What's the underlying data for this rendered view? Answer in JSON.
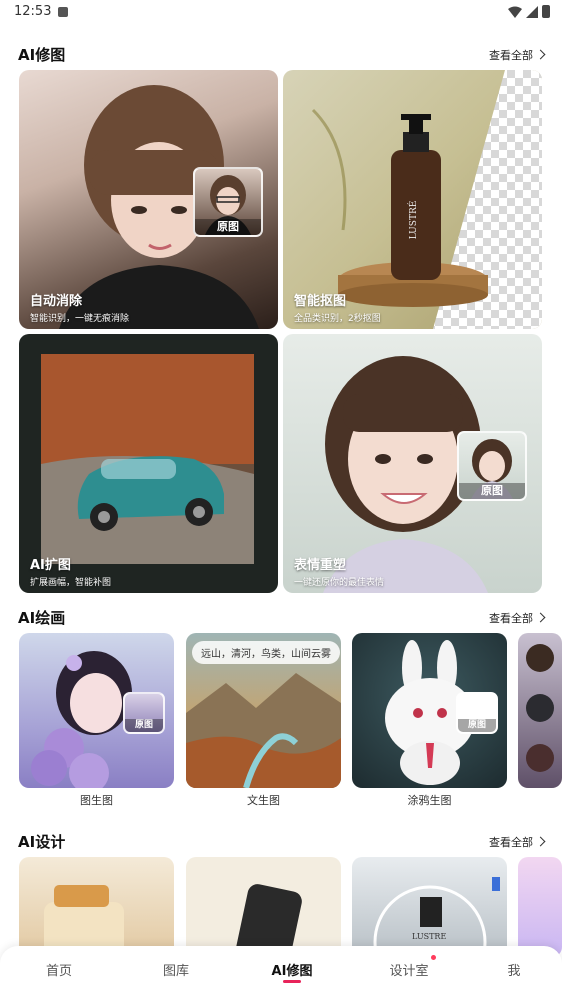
{
  "status_bar": {
    "time": "12:53"
  },
  "sections": {
    "retouch": {
      "title": "AI修图",
      "see_all": "查看全部",
      "cards": [
        {
          "title": "自动消除",
          "subtitle": "智能识别，一键无痕消除",
          "badge": "原图"
        },
        {
          "title": "智能抠图",
          "subtitle": "全品类识别，2秒抠图",
          "product_text": "LUSTRÉ"
        },
        {
          "title": "AI扩图",
          "subtitle": "扩展画幅，智能补图"
        },
        {
          "title": "表情重塑",
          "subtitle": "一键还原你的最佳表情",
          "badge": "原图"
        }
      ]
    },
    "painting": {
      "title": "AI绘画",
      "see_all": "查看全部",
      "items": [
        {
          "caption": "图生图",
          "badge": "原图"
        },
        {
          "caption": "文生图",
          "prompt": "远山，清河，鸟类，山间云雾"
        },
        {
          "caption": "涂鸦生图",
          "badge": "原图"
        }
      ]
    },
    "design": {
      "title": "AI设计",
      "see_all": "查看全部",
      "product_text": "LUSTRE"
    }
  },
  "nav": {
    "items": [
      "首页",
      "图库",
      "AI修图",
      "设计室",
      "我"
    ],
    "active_index": 2
  },
  "colors": {
    "accent": "#e8245a",
    "dot": "#ff3b5c"
  }
}
